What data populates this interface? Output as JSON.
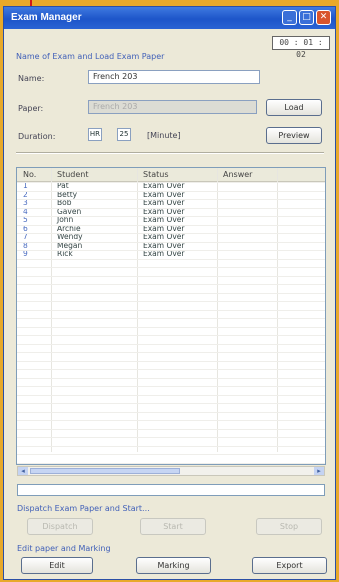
{
  "window": {
    "title": "Exam Manager",
    "counter": "00 : 01 : 02"
  },
  "titlebar": {
    "minimize": "_",
    "maximize": "□",
    "close": "✕"
  },
  "load_group": {
    "title": "Name of Exam and Load Exam Paper",
    "name_label": "Name:",
    "name_value": "French 203",
    "paper_label": "Paper:",
    "paper_value": "French 203",
    "duration_label": "Duration:",
    "duration_hours": "HR",
    "duration_minutes": "25",
    "duration_unit": "[Minute]",
    "load_button": "Load",
    "preview_button": "Preview"
  },
  "table": {
    "headers": [
      "No.",
      "Student",
      "Status",
      "Answer"
    ],
    "rows": [
      {
        "no": "1",
        "student": "Pat",
        "status": "Exam Over",
        "answer": ""
      },
      {
        "no": "2",
        "student": "Betty",
        "status": "Exam Over",
        "answer": ""
      },
      {
        "no": "3",
        "student": "Bob",
        "status": "Exam Over",
        "answer": ""
      },
      {
        "no": "4",
        "student": "Gaven",
        "status": "Exam Over",
        "answer": ""
      },
      {
        "no": "5",
        "student": "John",
        "status": "Exam Over",
        "answer": ""
      },
      {
        "no": "6",
        "student": "Archie",
        "status": "Exam Over",
        "answer": ""
      },
      {
        "no": "7",
        "student": "Wendy",
        "status": "Exam Over",
        "answer": ""
      },
      {
        "no": "8",
        "student": "Megan",
        "status": "Exam Over",
        "answer": ""
      },
      {
        "no": "9",
        "student": "Rick",
        "status": "Exam Over",
        "answer": ""
      }
    ]
  },
  "scroll": {
    "left": "◂",
    "right": "▸"
  },
  "dispatch_group": {
    "title": "Dispatch Exam Paper and Start...",
    "dispatch_button": "Dispatch",
    "start_button": "Start",
    "stop_button": "Stop"
  },
  "edit_group": {
    "title": "Edit paper and Marking",
    "edit_button": "Edit",
    "marking_button": "Marking",
    "export_button": "Export"
  }
}
